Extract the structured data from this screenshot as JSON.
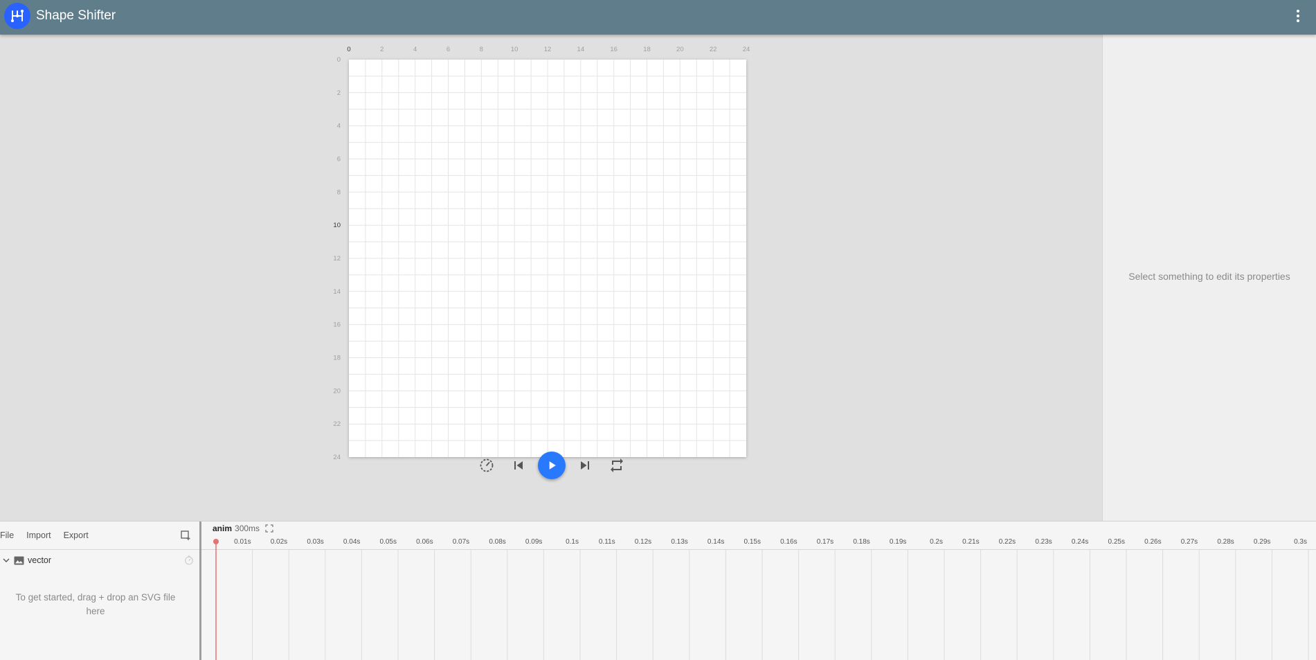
{
  "app": {
    "title": "Shape Shifter",
    "logo_icon": "shape-shifter-logo-icon",
    "menu_icon": "more-vert-icon",
    "toolbar_color": "#607d8b",
    "accent_color": "#2979ff"
  },
  "canvas": {
    "x_ruler_labels": [
      "0",
      "2",
      "4",
      "6",
      "8",
      "10",
      "12",
      "14",
      "16",
      "18",
      "20",
      "22",
      "24"
    ],
    "y_ruler_labels": [
      "0",
      "2",
      "4",
      "6",
      "8",
      "10",
      "12",
      "14",
      "16",
      "18",
      "20",
      "22",
      "24"
    ]
  },
  "playback": {
    "buttons": [
      {
        "name": "playback-speed-button",
        "icon": "timer-icon"
      },
      {
        "name": "skip-previous-button",
        "icon": "skip-previous-icon"
      },
      {
        "name": "play-button",
        "icon": "play-icon"
      },
      {
        "name": "skip-next-button",
        "icon": "skip-next-icon"
      },
      {
        "name": "repeat-button",
        "icon": "repeat-icon"
      }
    ]
  },
  "properties": {
    "empty_message": "Select something to edit its properties"
  },
  "layers": {
    "menu": {
      "file": "File",
      "import": "Import",
      "export": "Export"
    },
    "add_layer_icon": "add-layer-icon",
    "vector_label": "vector",
    "empty_hint": "To get started, drag + drop an SVG file here"
  },
  "timeline": {
    "animation_name": "anim",
    "duration": "300ms",
    "ticks": [
      "0.01s",
      "0.02s",
      "0.03s",
      "0.04s",
      "0.05s",
      "0.06s",
      "0.07s",
      "0.08s",
      "0.09s",
      "0.1s",
      "0.11s",
      "0.12s",
      "0.13s",
      "0.14s",
      "0.15s",
      "0.16s",
      "0.17s",
      "0.18s",
      "0.19s",
      "0.2s",
      "0.21s",
      "0.22s",
      "0.23s",
      "0.24s",
      "0.25s",
      "0.26s",
      "0.27s",
      "0.28s",
      "0.29s",
      "0.3s"
    ],
    "playhead_color": "#e57373"
  }
}
